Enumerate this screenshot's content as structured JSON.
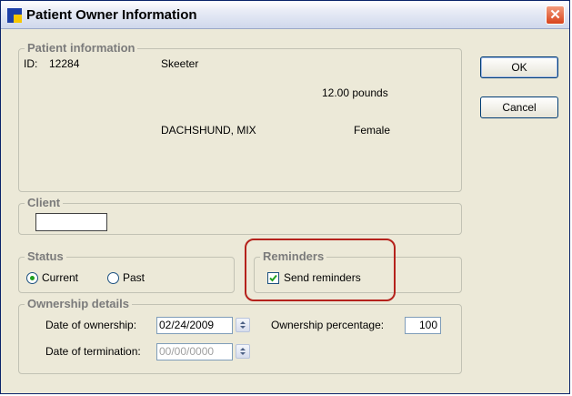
{
  "window": {
    "title": "Patient Owner Information",
    "close_glyph": "✕"
  },
  "patient": {
    "legend": "Patient information",
    "id_label": "ID:",
    "id_value": "12284",
    "name": "Skeeter",
    "weight": "12.00 pounds",
    "breed": "DACHSHUND, MIX",
    "sex": "Female"
  },
  "buttons": {
    "ok": "OK",
    "cancel": "Cancel"
  },
  "client": {
    "legend": "Client",
    "value": ""
  },
  "status": {
    "legend": "Status",
    "options": [
      "Current",
      "Past"
    ],
    "selected": "Current"
  },
  "reminders": {
    "legend": "Reminders",
    "send_label": "Send reminders",
    "send_checked": true
  },
  "ownership": {
    "legend": "Ownership details",
    "date_label": "Date of ownership:",
    "date_value": "02/24/2009",
    "termination_label": "Date of termination:",
    "termination_value": "00/00/0000",
    "percentage_label": "Ownership percentage:",
    "percentage_value": "100"
  },
  "colors": {
    "highlight": "#b5221c",
    "legend_text": "#7b7b7b",
    "titlebar_close": "#d8441c"
  }
}
